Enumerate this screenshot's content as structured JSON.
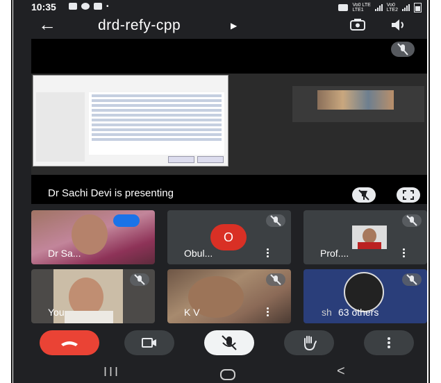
{
  "status_bar": {
    "time": "10:35",
    "carrier1": "Vo0 LTE",
    "carrier2": "Vo0",
    "lte_label": "LTE1",
    "lte2_label": "LTE2"
  },
  "top_bar": {
    "meeting_code": "drd-refy-cpp"
  },
  "presentation": {
    "caption": "Dr Sachi Devi is presenting"
  },
  "participants": [
    {
      "name": "Dr Sa..."
    },
    {
      "name": "Obul...",
      "avatar_letter": "O"
    },
    {
      "name": "Prof...."
    },
    {
      "name": "You"
    },
    {
      "name": "K V"
    },
    {
      "name": "63 others",
      "overlay_text": "sh"
    }
  ],
  "colors": {
    "background": "#202124",
    "end_call": "#ea4335",
    "avatar": "#d93025",
    "tile": "#3c4043"
  },
  "icons": [
    "back-arrow-icon",
    "play-icon",
    "switch-camera-icon",
    "speaker-icon",
    "mic-off-icon",
    "fullscreen-icon",
    "end-call-icon",
    "camera-icon",
    "raise-hand-icon",
    "more-vert-icon"
  ]
}
